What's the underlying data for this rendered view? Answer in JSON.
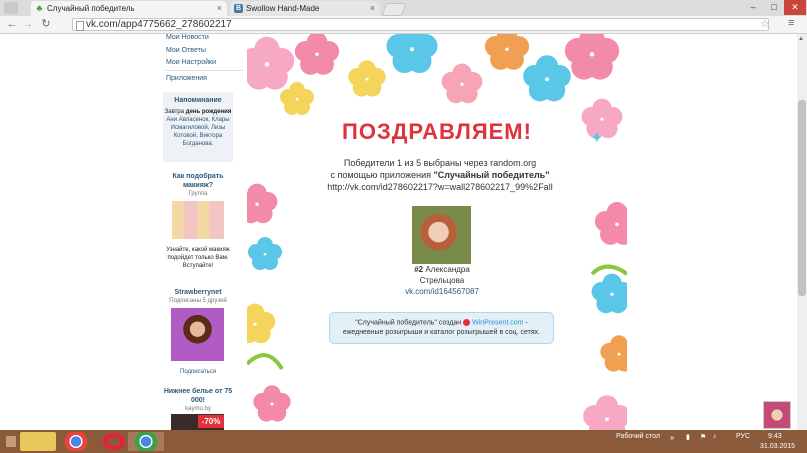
{
  "browser": {
    "tabs": [
      {
        "title": "Случайный победитель",
        "icon": "clover-icon"
      },
      {
        "title": "Swollow Hand-Made",
        "icon": "vk-icon"
      }
    ],
    "url": "vk.com/app4775662_278602217",
    "window_buttons": [
      "–",
      "□",
      "✕"
    ]
  },
  "sidebar": {
    "menu": [
      "Мои Новости",
      "Мои Ответы",
      "Мои Настройки",
      "Приложения"
    ],
    "reminder": {
      "title": "Напоминание",
      "text_prefix": "Завтра",
      "text_bold": "день рождения",
      "names": "Ани Авласенок, Клары Исмагиловой, Лизы Котовой, Виктора Богданова."
    },
    "ads": [
      {
        "title": "Как подобрать макияж?",
        "subtitle": "Группа",
        "body": "Узнайте, какой макияж подойдет только Вам. Вступайте!"
      },
      {
        "title": "Strawberrynet",
        "subtitle": "Подписаны 5 друзей",
        "body": "Подписаться"
      },
      {
        "title": "Нижнее белье от 75 000!",
        "subtitle": "kaymu.by",
        "badge": "-70%"
      }
    ]
  },
  "main": {
    "heading": "ПОЗДРАВЛЯЕМ!",
    "line1": "Победители 1 из 5 выбраны через random.org",
    "line2_prefix": "с помощью приложения",
    "line2_app": "\"Случайный победитель\"",
    "line3": "http://vk.com/id278602217?w=wall278602217_99%2Fall",
    "winner": {
      "rank": "#2",
      "name_first": "Александра",
      "name_last": "Стрельцова",
      "link": "vk.com/id164567087"
    },
    "notice": {
      "prefix": "\"Случайный победитель\" создан",
      "brand": "WinPresent.com",
      "suffix": "-",
      "line2": "ежедневные розыгрыши и каталог розыгрышей в соц. сетях."
    }
  },
  "taskbar": {
    "desktop_label": "Рабочий стол",
    "lang": "РУС",
    "time": "9:43",
    "date": "31.03.2015"
  },
  "colors": {
    "accent_red": "#e1323c",
    "vk_blue": "#2b587a",
    "taskbar": "#8a5a3a"
  }
}
